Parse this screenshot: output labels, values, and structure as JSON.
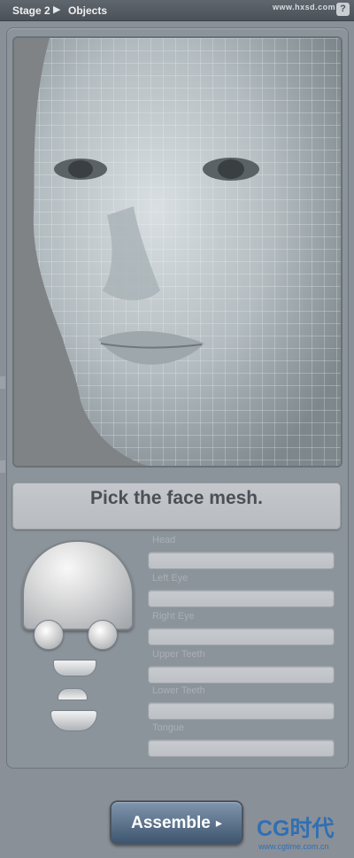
{
  "header": {
    "breadcrumb_stage": "Stage 2",
    "breadcrumb_page": "Objects",
    "help_label": "?",
    "watermark": "www.hxsd.com"
  },
  "instruction": "Pick the face mesh.",
  "mesh_slots": [
    {
      "label": "Head",
      "value": ""
    },
    {
      "label": "Left Eye",
      "value": ""
    },
    {
      "label": "Right Eye",
      "value": ""
    },
    {
      "label": "Upper Teeth",
      "value": ""
    },
    {
      "label": "Lower Teeth",
      "value": ""
    },
    {
      "label": "Tongue",
      "value": ""
    }
  ],
  "assemble_button": {
    "label": "Assemble",
    "icon": "arrow-right-icon"
  },
  "watermark_bottom": {
    "logo": "CG时代",
    "url": "www.cgtime.com.cn"
  },
  "colors": {
    "panel": "#8c949b",
    "prompt_bg": "#c4c8cc",
    "button_blue": "#3f5670",
    "watermark_blue": "#2f6fb5"
  }
}
